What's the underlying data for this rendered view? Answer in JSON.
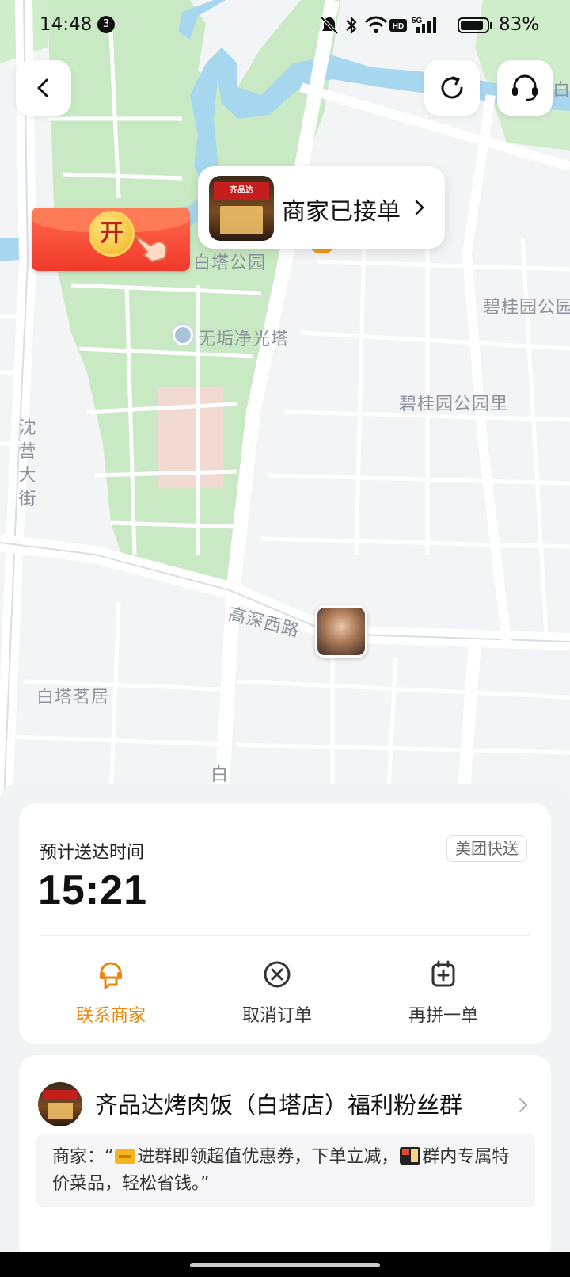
{
  "status_bar": {
    "time": "14:48",
    "notification_count": "3",
    "battery": "83%",
    "icons": [
      "mute-icon",
      "bluetooth-icon",
      "wifi-icon",
      "hd-icon",
      "signal-5g-icon",
      "battery-icon"
    ]
  },
  "map": {
    "labels": {
      "park": "白塔公园",
      "pagoda": "无垢净光塔",
      "biguiyuan_top": "碧桂园公园",
      "biguiyuan": "碧桂园公园里",
      "street_vertical": "沈营大街",
      "road": "高深西路",
      "residence": "白塔茗居",
      "bottom_cut": "白",
      "right_cut": "白"
    },
    "colors": {
      "park": "#c9e9c4",
      "water": "#a7d7ef",
      "road": "#ffffff",
      "block": "#e7e9ee"
    }
  },
  "toolbar": {
    "back_icon": "back-icon",
    "refresh_icon": "refresh-icon",
    "service_icon": "headset-icon"
  },
  "merchant_bubble": {
    "status": "商家已接单",
    "thumb_sign": "齐品达"
  },
  "red_packet": {
    "label": "开"
  },
  "eta": {
    "label": "预计送达时间",
    "time": "15:21",
    "badge": "美团快送"
  },
  "actions": [
    {
      "label": "联系商家",
      "icon": "chat-merchant-icon"
    },
    {
      "label": "取消订单",
      "icon": "cancel-icon"
    },
    {
      "label": "再拼一单",
      "icon": "add-order-icon"
    }
  ],
  "group": {
    "name": "齐品达烤肉饭（白塔店）福利粉丝群",
    "msg_a": "商家：“",
    "msg_b": "进群即领超值优惠券，下单立减，",
    "msg_c": "群内专属特价菜品，轻松省钱。”"
  },
  "accent_color": "#f39b12"
}
